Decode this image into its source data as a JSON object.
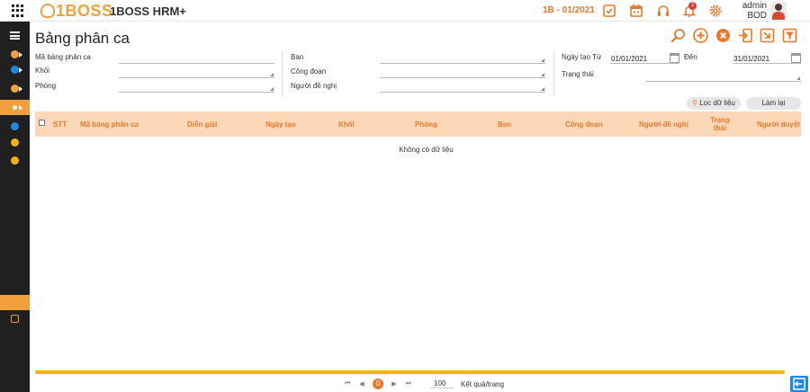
{
  "header": {
    "brand": "1BOSS",
    "app_name": "1BOSS HRM+",
    "period": "1B - 01/2021",
    "notification_count": "2",
    "user_name": "admin",
    "user_role": "BOD",
    "accent_color": "#e8792a",
    "icons": [
      "apps-grid-icon",
      "task-check-icon",
      "calendar-icon",
      "headset-icon",
      "bell-icon",
      "gear-icon"
    ]
  },
  "sidebar": {
    "items": [
      {
        "icon": "menu-icon",
        "color": "#ffffff"
      },
      {
        "icon": "module-icon",
        "color": "#f2a03d"
      },
      {
        "icon": "module-icon",
        "color": "#1e88e5"
      },
      {
        "icon": "module-icon",
        "color": "#f2a03d"
      },
      {
        "icon": "module-icon",
        "color": "#f2a03d",
        "active": true
      },
      {
        "icon": "module-icon",
        "color": "#1e88e5"
      },
      {
        "icon": "module-icon",
        "color": "#f5b215"
      },
      {
        "icon": "module-icon",
        "color": "#f5b215"
      }
    ]
  },
  "page": {
    "title": "Bảng phân ca",
    "actions": [
      "search-icon",
      "add-icon",
      "delete-icon",
      "import-icon",
      "export-icon",
      "filter-icon"
    ]
  },
  "filters": {
    "ma_bang_phan_ca": {
      "label": "Mã bảng phân ca",
      "value": ""
    },
    "khoi": {
      "label": "Khối",
      "value": ""
    },
    "phong": {
      "label": "Phòng",
      "value": ""
    },
    "ban": {
      "label": "Ban",
      "value": ""
    },
    "cong_doan": {
      "label": "Công đoạn",
      "value": ""
    },
    "nguoi_de_nghi": {
      "label": "Người đề nghị",
      "value": ""
    },
    "ngay_tao_tu": {
      "label": "Ngày tạo Từ",
      "value": "01/01/2021"
    },
    "den": {
      "label": "Đến",
      "value": "31/01/2021"
    },
    "trang_thai": {
      "label": "Trạng thái",
      "value": ""
    },
    "filter_button": "Lọc dữ liệu",
    "reset_button": "Làm lại"
  },
  "table": {
    "columns": [
      "STT",
      "Mã bảng phân ca",
      "Diễn giải",
      "Ngày tạo",
      "Khối",
      "Phòng",
      "Ban",
      "Công đoạn",
      "Người đề nghị",
      "Trạng thái",
      "Người duyệt"
    ],
    "empty_text": "Không có dữ liệu",
    "rows": []
  },
  "pagination": {
    "current_page": "0",
    "page_size": "100",
    "per_page_label": "Kết quả/trang"
  }
}
